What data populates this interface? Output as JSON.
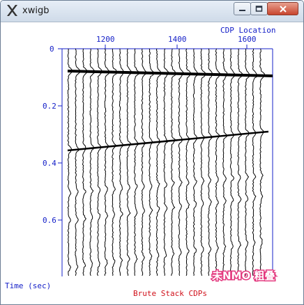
{
  "window": {
    "title": "xwigb",
    "app_icon": "x-logo-icon",
    "controls": [
      "minimize-icon",
      "maximize-icon",
      "close-icon"
    ]
  },
  "plot": {
    "x_axis_title": "CDP Location",
    "x_ticks": [
      "1200",
      "1400",
      "1600"
    ],
    "y_ticks": [
      "0",
      "0.2",
      "0.4",
      "0.6"
    ],
    "y_axis_title": "Time (sec)",
    "caption": "Brute Stack CDPs",
    "stamp": "未NMO 粗叠",
    "colors": {
      "axis": "#1520c8",
      "caption": "#d0101a",
      "traces": "#000000",
      "stamp": "#e3357c"
    }
  }
}
